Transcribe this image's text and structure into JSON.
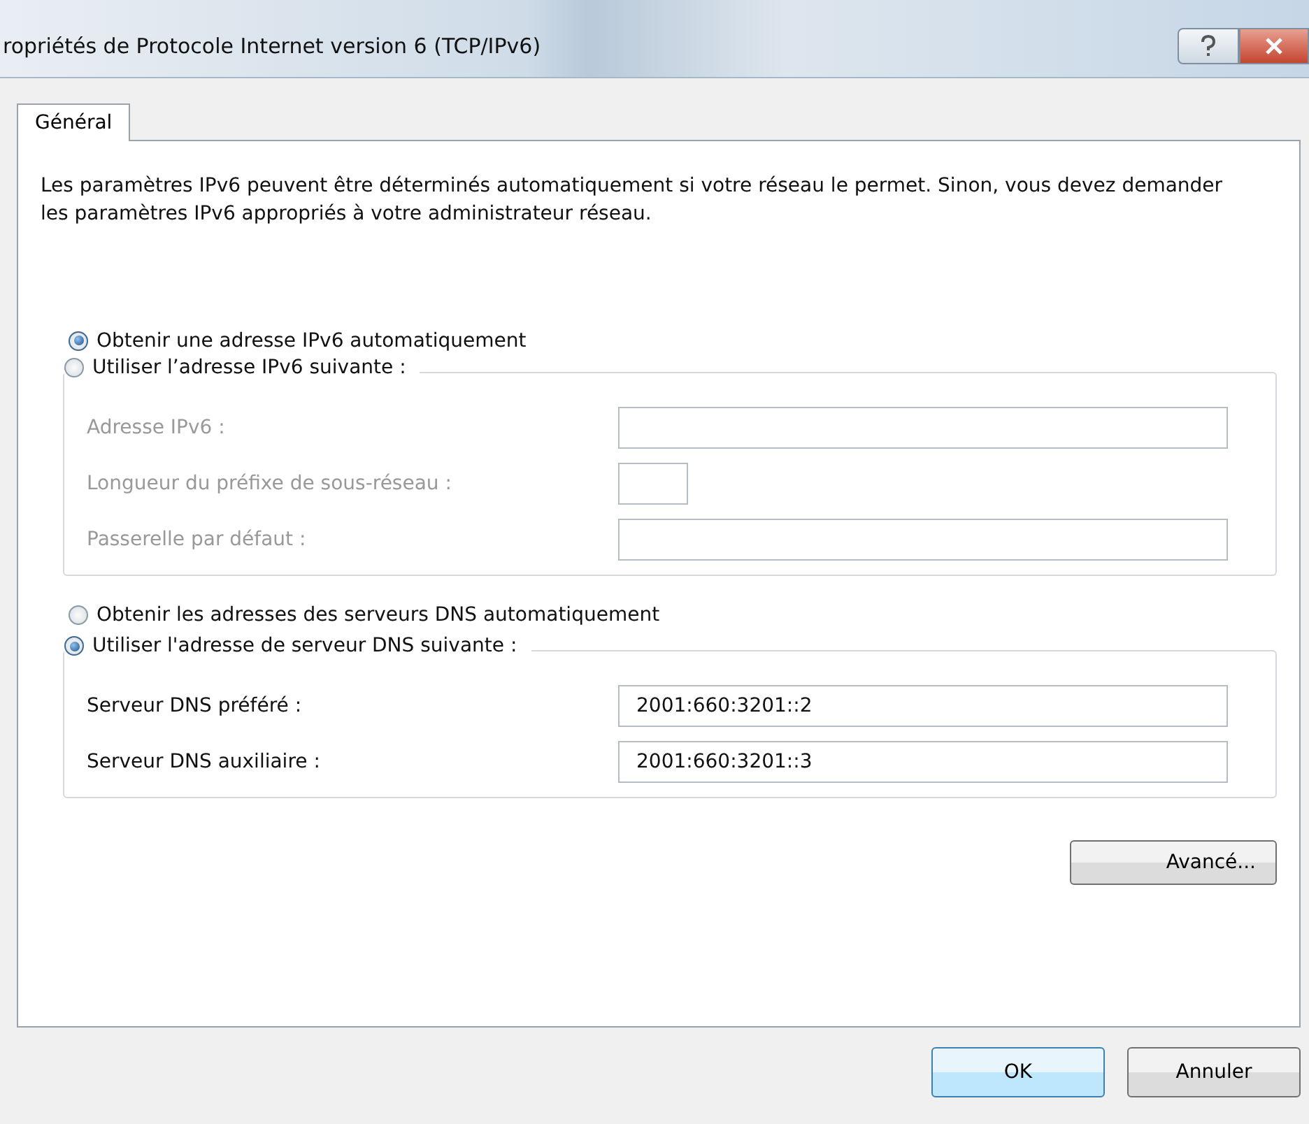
{
  "window": {
    "title": "ropriétés de Protocole Internet version 6 (TCP/IPv6)"
  },
  "tabs": [
    {
      "label": "Général",
      "selected": true
    }
  ],
  "description": "Les paramètres IPv6 peuvent être déterminés automatiquement si votre réseau le permet. Sinon, vous devez demander les paramètres IPv6 appropriés à votre administrateur réseau.",
  "address_options": [
    {
      "label": "Obtenir une adresse IPv6 automatiquement",
      "selected": true
    },
    {
      "label": "Utiliser l’adresse IPv6 suivante :",
      "selected": false
    }
  ],
  "address_fields": [
    {
      "label": "Adresse IPv6 :",
      "disabled": true,
      "kind": "text"
    },
    {
      "label": "Longueur du préfixe de sous-réseau :",
      "disabled": true,
      "kind": "prefix"
    },
    {
      "label": "Passerelle par défaut :",
      "disabled": true,
      "kind": "text"
    }
  ],
  "dns_options": [
    {
      "label": "Obtenir les adresses des serveurs DNS automatiquement",
      "selected": false
    },
    {
      "label": "Utiliser l'adresse de serveur DNS suivante :",
      "selected": true
    }
  ],
  "dns_fields": [
    {
      "label": "Serveur DNS préféré :",
      "disabled": false,
      "kind": "text",
      "value": "2001:660:3201::2"
    },
    {
      "label": "Serveur DNS auxiliaire :",
      "disabled": false,
      "kind": "text",
      "value": "2001:660:3201::3"
    }
  ],
  "advanced_button": "Avancé...",
  "buttons": [
    {
      "label": "OK",
      "default": true
    },
    {
      "label": "Annuler",
      "default": false
    }
  ]
}
